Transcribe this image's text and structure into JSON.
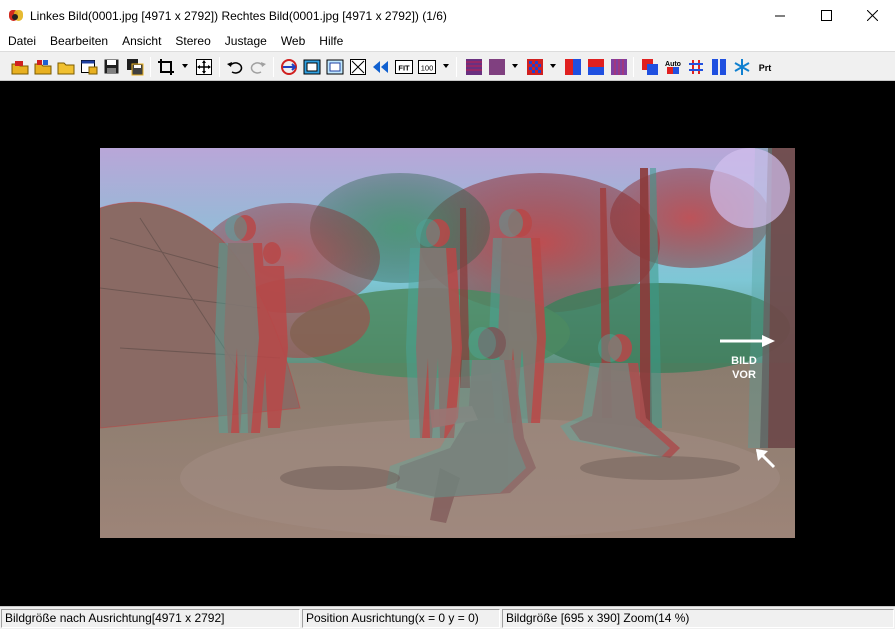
{
  "window": {
    "title": "Linkes Bild(0001.jpg [4971 x 2792]) Rechtes Bild(0001.jpg [4971 x 2792])  (1/6)",
    "app_icon": "stereophoto-maker-icon",
    "controls": [
      "minimize-icon",
      "maximize-icon",
      "close-icon"
    ]
  },
  "menu": {
    "items": [
      {
        "label": "Datei"
      },
      {
        "label": "Bearbeiten"
      },
      {
        "label": "Ansicht"
      },
      {
        "label": "Stereo"
      },
      {
        "label": "Justage"
      },
      {
        "label": "Web"
      },
      {
        "label": "Hilfe"
      }
    ]
  },
  "toolbar": {
    "buttons": [
      {
        "icon": "open-stereo-icon"
      },
      {
        "icon": "open-left-right-icon"
      },
      {
        "icon": "open-folder-icon"
      },
      {
        "icon": "open-window-icon"
      },
      {
        "icon": "save-icon"
      },
      {
        "icon": "save-all-icon"
      },
      {
        "icon": "crop-icon"
      },
      {
        "icon": "move-icon"
      },
      {
        "icon": "undo-icon"
      },
      {
        "icon": "redo-icon"
      },
      {
        "icon": "swap-icon"
      },
      {
        "icon": "fit-frame-icon"
      },
      {
        "icon": "frame-icon"
      },
      {
        "icon": "full-screen-icon"
      },
      {
        "icon": "side-by-side-icon"
      },
      {
        "icon": "fit-icon"
      },
      {
        "icon": "zoom-100-icon"
      },
      {
        "icon": "anaglyph-gray-icon"
      },
      {
        "icon": "anaglyph-color-icon"
      },
      {
        "icon": "interlace-icon"
      },
      {
        "icon": "red-cyan-icon"
      },
      {
        "icon": "red-blue-icon"
      },
      {
        "icon": "purple-icon"
      },
      {
        "icon": "overlap-icon"
      },
      {
        "icon": "auto-align-icon"
      },
      {
        "icon": "grid-icon"
      },
      {
        "icon": "blue-bars-icon"
      },
      {
        "icon": "snowflake-icon"
      },
      {
        "icon": "print-icon"
      }
    ],
    "fit_label": "FIT",
    "zoom_label": "100",
    "auto_label": "Auto",
    "print_label": "Prt"
  },
  "image": {
    "overlay_text_line1": "BILD",
    "overlay_text_line2": "VOR"
  },
  "status": {
    "pane1": "Bildgröße nach Ausrichtung[4971 x 2792]",
    "pane2": "Position Ausrichtung(x = 0 y = 0)",
    "pane3": "Bildgröße [695 x 390]  Zoom(14 %)"
  },
  "colors": {
    "background": "#000000",
    "toolbar_bg": "#f0f0f0",
    "anaglyph_red": "#d43a3a",
    "anaglyph_cyan": "#3fbfb5"
  }
}
